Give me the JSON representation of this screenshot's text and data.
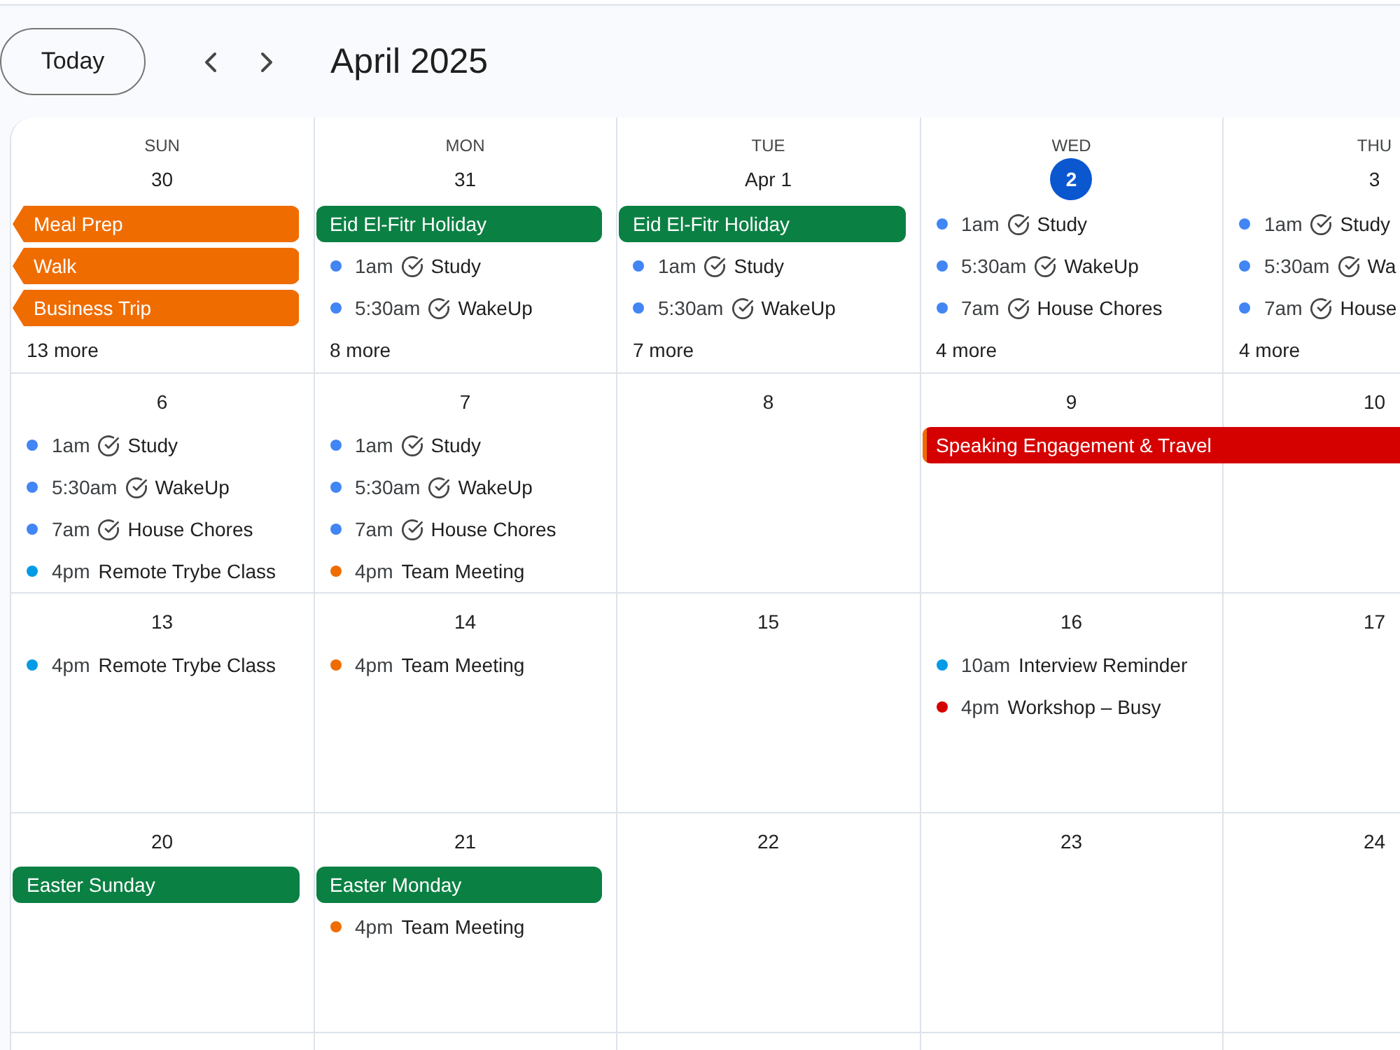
{
  "header": {
    "today_button": "Today",
    "title": "April 2025"
  },
  "weeks": [
    {
      "days": [
        {
          "weekday": "SUN",
          "date": "30",
          "today": false,
          "events": [
            {
              "kind": "chip",
              "title": "Meal Prep",
              "color": "#ef6c00",
              "continues_before": true,
              "continues_after": false
            },
            {
              "kind": "chip",
              "title": "Walk",
              "color": "#ef6c00",
              "continues_before": true,
              "continues_after": false
            },
            {
              "kind": "chip",
              "title": "Business Trip",
              "color": "#ef6c00",
              "continues_before": true,
              "continues_after": false
            }
          ],
          "more": "13 more"
        },
        {
          "weekday": "MON",
          "date": "31",
          "today": false,
          "events": [
            {
              "kind": "chip",
              "title": "Eid El-Fitr Holiday",
              "color": "#0b8043",
              "continues_before": false,
              "continues_after": false
            },
            {
              "kind": "dot",
              "time": "1am",
              "task": true,
              "title": "Study",
              "color": "#4285f4"
            },
            {
              "kind": "dot",
              "time": "5:30am",
              "task": true,
              "title": "WakeUp",
              "color": "#4285f4"
            }
          ],
          "more": "8 more"
        },
        {
          "weekday": "TUE",
          "date": "Apr 1",
          "today": false,
          "events": [
            {
              "kind": "chip",
              "title": "Eid El-Fitr Holiday",
              "color": "#0b8043",
              "continues_before": false,
              "continues_after": false
            },
            {
              "kind": "dot",
              "time": "1am",
              "task": true,
              "title": "Study",
              "color": "#4285f4"
            },
            {
              "kind": "dot",
              "time": "5:30am",
              "task": true,
              "title": "WakeUp",
              "color": "#4285f4"
            }
          ],
          "more": "7 more"
        },
        {
          "weekday": "WED",
          "date": "2",
          "today": true,
          "events": [
            {
              "kind": "dot",
              "time": "1am",
              "task": true,
              "title": "Study",
              "color": "#4285f4"
            },
            {
              "kind": "dot",
              "time": "5:30am",
              "task": true,
              "title": "WakeUp",
              "color": "#4285f4"
            },
            {
              "kind": "dot",
              "time": "7am",
              "task": true,
              "title": "House Chores",
              "color": "#4285f4"
            }
          ],
          "more": "4 more"
        },
        {
          "weekday": "THU",
          "date": "3",
          "today": false,
          "events": [
            {
              "kind": "dot",
              "time": "1am",
              "task": true,
              "title": "Study",
              "color": "#4285f4"
            },
            {
              "kind": "dot",
              "time": "5:30am",
              "task": true,
              "title": "Wa",
              "color": "#4285f4"
            },
            {
              "kind": "dot",
              "time": "7am",
              "task": true,
              "title": "House",
              "color": "#4285f4"
            }
          ],
          "more": "4 more"
        }
      ]
    },
    {
      "days": [
        {
          "date": "6",
          "today": false,
          "events": [
            {
              "kind": "dot",
              "time": "1am",
              "task": true,
              "title": "Study",
              "color": "#4285f4"
            },
            {
              "kind": "dot",
              "time": "5:30am",
              "task": true,
              "title": "WakeUp",
              "color": "#4285f4"
            },
            {
              "kind": "dot",
              "time": "7am",
              "task": true,
              "title": "House Chores",
              "color": "#4285f4"
            },
            {
              "kind": "dot",
              "time": "4pm",
              "task": false,
              "title": "Remote Trybe Class",
              "color": "#039be5"
            }
          ]
        },
        {
          "date": "7",
          "today": false,
          "events": [
            {
              "kind": "dot",
              "time": "1am",
              "task": true,
              "title": "Study",
              "color": "#4285f4"
            },
            {
              "kind": "dot",
              "time": "5:30am",
              "task": true,
              "title": "WakeUp",
              "color": "#4285f4"
            },
            {
              "kind": "dot",
              "time": "7am",
              "task": true,
              "title": "House Chores",
              "color": "#4285f4"
            },
            {
              "kind": "dot",
              "time": "4pm",
              "task": false,
              "title": "Team Meeting",
              "color": "#ef6c00"
            }
          ]
        },
        {
          "date": "8",
          "today": false
        },
        {
          "date": "9",
          "today": false,
          "events": [
            {
              "kind": "chip",
              "title": "Speaking Engagement & Travel",
              "color": "#d50000",
              "edge": {
                "color": "#ef6c00"
              },
              "continues_before": false,
              "continues_after": true
            }
          ]
        },
        {
          "date": "10",
          "today": false
        }
      ]
    },
    {
      "days": [
        {
          "date": "13",
          "today": false,
          "events": [
            {
              "kind": "dot",
              "time": "4pm",
              "task": false,
              "title": "Remote Trybe Class",
              "color": "#039be5"
            }
          ]
        },
        {
          "date": "14",
          "today": false,
          "events": [
            {
              "kind": "dot",
              "time": "4pm",
              "task": false,
              "title": "Team Meeting",
              "color": "#ef6c00"
            }
          ]
        },
        {
          "date": "15",
          "today": false
        },
        {
          "date": "16",
          "today": false,
          "events": [
            {
              "kind": "dot",
              "time": "10am",
              "task": false,
              "title": "Interview Reminder",
              "color": "#039be5"
            },
            {
              "kind": "dot",
              "time": "4pm",
              "task": false,
              "title": "Workshop – Busy",
              "color": "#d50000"
            }
          ]
        },
        {
          "date": "17",
          "today": false
        }
      ]
    },
    {
      "days": [
        {
          "date": "20",
          "today": false,
          "events": [
            {
              "kind": "chip",
              "title": "Easter Sunday",
              "color": "#0b8043",
              "continues_before": false,
              "continues_after": false
            }
          ]
        },
        {
          "date": "21",
          "today": false,
          "events": [
            {
              "kind": "chip",
              "title": "Easter Monday",
              "color": "#0b8043",
              "continues_before": false,
              "continues_after": false
            },
            {
              "kind": "dot",
              "time": "4pm",
              "task": false,
              "title": "Team Meeting",
              "color": "#ef6c00"
            }
          ]
        },
        {
          "date": "22",
          "today": false
        },
        {
          "date": "23",
          "today": false
        },
        {
          "date": "24",
          "today": false
        }
      ]
    }
  ]
}
